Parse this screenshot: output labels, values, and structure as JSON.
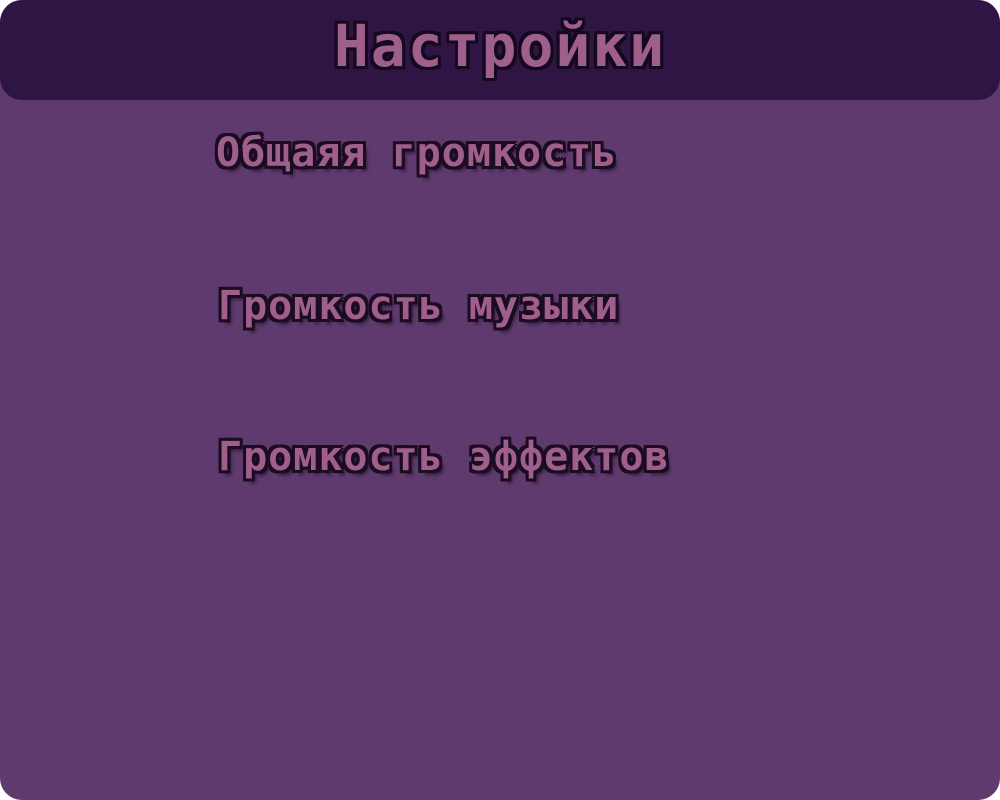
{
  "header": {
    "title": "Настройки"
  },
  "settings": {
    "items": [
      {
        "label": "Общаяя громкость"
      },
      {
        "label": "Громкость музыки"
      },
      {
        "label": "Громкость эффектов"
      }
    ]
  },
  "colors": {
    "panel_background": "#5e3a6e",
    "header_background": "#2e1544",
    "text_fill": "#9e5f8c",
    "text_outline": "#1c0c22"
  }
}
